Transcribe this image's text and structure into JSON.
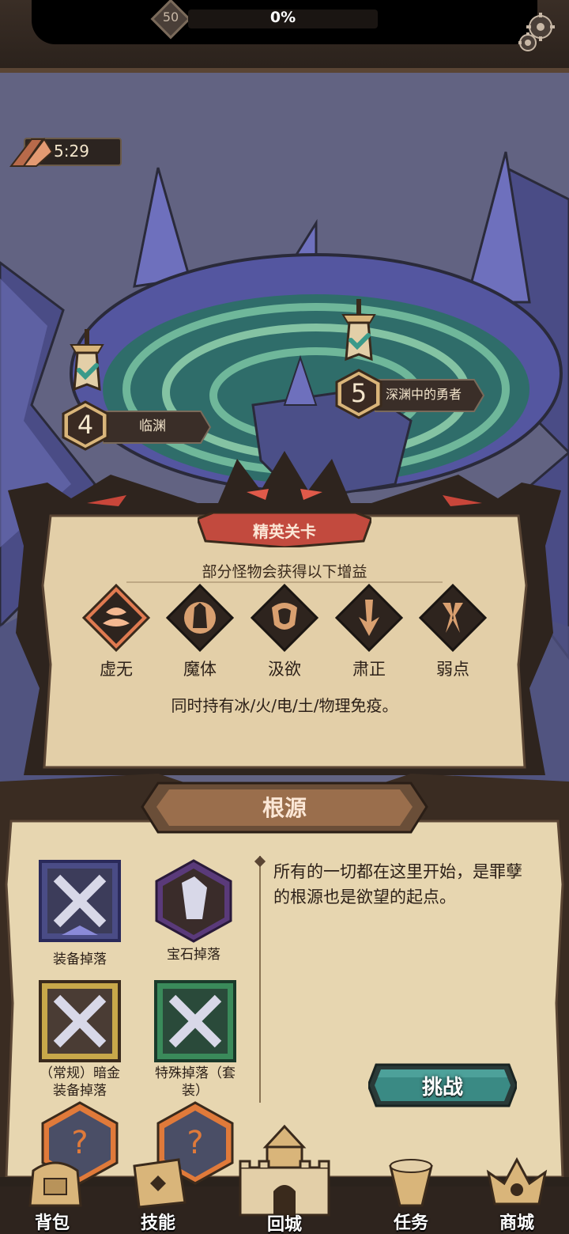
{
  "topbar": {
    "level": "50",
    "exp_percent": "0%",
    "settings_icon": "gear-icon"
  },
  "map": {
    "timer": "5:29",
    "stages": [
      {
        "number": "4",
        "name": "临渊",
        "completed": true
      },
      {
        "number": "5",
        "name": "深渊中的勇者",
        "completed": true
      }
    ]
  },
  "elite": {
    "title": "精英关卡",
    "heading": "部分怪物会获得以下增益",
    "buffs": [
      {
        "label": "虚无",
        "icon": "void-icon",
        "selected": true
      },
      {
        "label": "魔体",
        "icon": "demon-body-icon",
        "selected": false
      },
      {
        "label": "汲欲",
        "icon": "desire-drain-icon",
        "selected": false
      },
      {
        "label": "肃正",
        "icon": "purge-icon",
        "selected": false
      },
      {
        "label": "弱点",
        "icon": "weakness-icon",
        "selected": false
      }
    ],
    "description": "同时持有冰/火/电/土/物理免疫。"
  },
  "info": {
    "title": "根源",
    "drops": [
      {
        "label": "装备掉落",
        "icon": "equipment-drop-icon"
      },
      {
        "label": "宝石掉落",
        "icon": "gem-drop-icon"
      },
      {
        "label_line1": "（常规）暗金",
        "label_line2": "装备掉落",
        "icon": "dark-gold-equipment-icon"
      },
      {
        "label_line1": "特殊掉落（套",
        "label_line2": "装）",
        "icon": "set-equipment-icon"
      },
      {
        "icon": "unknown-drop-icon"
      },
      {
        "icon": "unknown-drop-icon"
      }
    ],
    "description": "所有的一切都在这里开始，是罪孽的根源也是欲望的起点。",
    "challenge_label": "挑战"
  },
  "nav": [
    {
      "label": "背包",
      "icon": "backpack-icon"
    },
    {
      "label": "技能",
      "icon": "skill-icon"
    },
    {
      "label": "回城",
      "icon": "castle-icon"
    },
    {
      "label": "任务",
      "icon": "quest-icon"
    },
    {
      "label": "商城",
      "icon": "shop-icon"
    }
  ],
  "colors": {
    "parchment": "#e3cfa8",
    "frame": "#3a2c22",
    "accent_red": "#b84a3a",
    "teal_button": "#3a8a84",
    "map_bg": "#5f5f7e"
  }
}
